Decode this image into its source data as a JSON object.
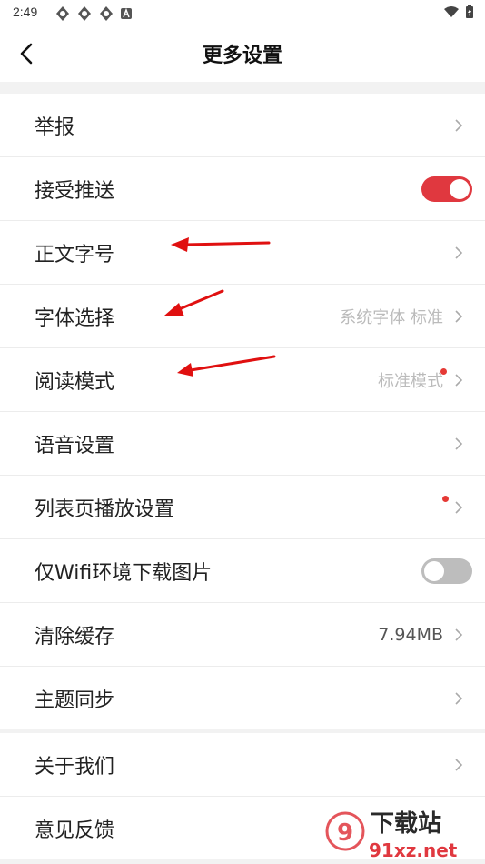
{
  "status_bar": {
    "time": "2:49"
  },
  "header": {
    "title": "更多设置"
  },
  "settings_group1": [
    {
      "id": "report",
      "label": "举报",
      "control": "chevron"
    },
    {
      "id": "push",
      "label": "接受推送",
      "control": "toggle",
      "enabled": true
    },
    {
      "id": "font-size",
      "label": "正文字号",
      "control": "chevron"
    },
    {
      "id": "font-select",
      "label": "字体选择",
      "control": "chevron",
      "value": "系统字体 标准"
    },
    {
      "id": "reading-mode",
      "label": "阅读模式",
      "control": "chevron",
      "value": "标准模式",
      "badge": true
    },
    {
      "id": "voice",
      "label": "语音设置",
      "control": "chevron"
    },
    {
      "id": "list-playback",
      "label": "列表页播放设置",
      "control": "chevron",
      "badge": true
    },
    {
      "id": "wifi-images",
      "label": "仅Wifi环境下载图片",
      "control": "toggle",
      "enabled": false
    },
    {
      "id": "clear-cache",
      "label": "清除缓存",
      "control": "chevron",
      "value": "7.94MB"
    },
    {
      "id": "theme-sync",
      "label": "主题同步",
      "control": "chevron"
    }
  ],
  "settings_group2": [
    {
      "id": "about",
      "label": "关于我们",
      "control": "chevron"
    },
    {
      "id": "feedback",
      "label": "意见反馈",
      "control": "chevron"
    }
  ],
  "watermark": {
    "text": "下载站",
    "url": "91xz.net"
  },
  "colors": {
    "accent": "#e0383f",
    "badge": "#e53935",
    "annotation_arrow": "#e01010"
  }
}
